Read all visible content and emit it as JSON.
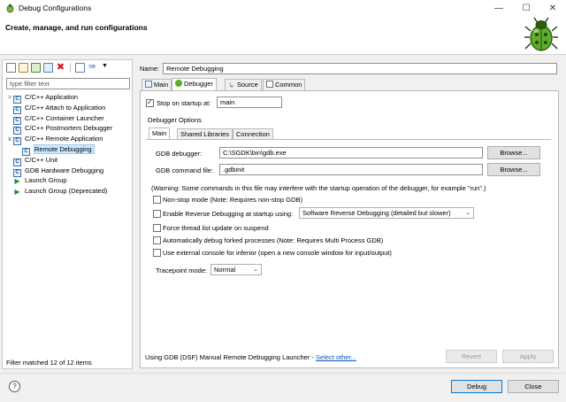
{
  "window": {
    "title": "Debug Configurations",
    "minimize": "—",
    "maximize": "☐",
    "close": "✕"
  },
  "header": {
    "title": "Create, manage, and run configurations",
    "banner_icon": "bug-icon"
  },
  "toolbar": {
    "icons": [
      "new-configuration-icon",
      "new-prototype-icon",
      "export-icon",
      "duplicate-icon",
      "delete-icon",
      "collapse-all-icon",
      "filter-icon",
      "chevron-down-icon"
    ]
  },
  "filter": {
    "placeholder": "type filter text"
  },
  "tree": [
    {
      "label": "C/C++ Application",
      "twisty": ">",
      "icon": "C",
      "level": 0
    },
    {
      "label": "C/C++ Attach to Application",
      "twisty": "",
      "icon": "C",
      "level": 0
    },
    {
      "label": "C/C++ Container Launcher",
      "twisty": "",
      "icon": "C",
      "level": 0
    },
    {
      "label": "C/C++ Postmortem Debugger",
      "twisty": "",
      "icon": "C",
      "level": 0
    },
    {
      "label": "C/C++ Remote Application",
      "twisty": "∨",
      "icon": "C",
      "level": 0
    },
    {
      "label": "Remote Debugging",
      "twisty": "",
      "icon": "C",
      "level": 1,
      "selected": true
    },
    {
      "label": "C/C++ Unit",
      "twisty": "",
      "icon": "C",
      "level": 0
    },
    {
      "label": "GDB Hardware Debugging",
      "twisty": "",
      "icon": "C",
      "level": 0
    },
    {
      "label": "Launch Group",
      "twisty": "",
      "icon": "launch-group",
      "level": 0
    },
    {
      "label": "Launch Group (Deprecated)",
      "twisty": "",
      "icon": "launch-group",
      "level": 0
    }
  ],
  "filter_status": "Filter matched 12 of 12 items",
  "config": {
    "name_label": "Name:",
    "name_value": "Remote Debugging",
    "tabs": [
      {
        "label": "Main",
        "icon": "main-tab-icon"
      },
      {
        "label": "Debugger",
        "icon": "debugger-tab-icon",
        "active": true
      },
      {
        "label": "Source",
        "icon": "source-tab-icon"
      },
      {
        "label": "Common",
        "icon": "common-tab-icon"
      }
    ],
    "stop_on_startup": {
      "label": "Stop on startup at:",
      "checked": true,
      "value": "main"
    },
    "debugger_options_label": "Debugger Options",
    "inner_tabs": [
      {
        "label": "Main",
        "active": true
      },
      {
        "label": "Shared Libraries"
      },
      {
        "label": "Connection"
      }
    ],
    "gdb_debugger": {
      "label": "GDB debugger:",
      "value": "C:\\SGDK\\bin\\gdb.exe",
      "browse": "Browse..."
    },
    "gdb_command_file": {
      "label": "GDB command file:",
      "value": ".gdbinit",
      "browse": "Browse..."
    },
    "warning": "(Warning: Some commands in this file may interfere with the startup operation of the debugger, for example \"run\".)",
    "non_stop": "Non-stop mode (Note: Requires non-stop GDB)",
    "reverse_debugging": {
      "label": "Enable Reverse Debugging at startup using:",
      "option": "Software Reverse Debugging (detailed but slower)"
    },
    "force_thread": "Force thread list update on suspend",
    "auto_debug_forked": "Automatically debug forked processes (Note: Requires Multi Process GDB)",
    "external_console": "Use external console for inferior (open a new console window for input/output)",
    "tracepoint_mode": {
      "label": "Tracepoint mode:",
      "value": "Normal"
    }
  },
  "launcher": {
    "text": "Using GDB (DSF) Manual Remote Debugging Launcher - ",
    "link": "Select other..."
  },
  "buttons": {
    "revert": "Revert",
    "apply": "Apply",
    "debug": "Debug",
    "close": "Close",
    "help": "?"
  },
  "colors": {
    "selection": "#cce8ff",
    "link": "#0a57b4",
    "default_button_border": "#0078d7"
  }
}
